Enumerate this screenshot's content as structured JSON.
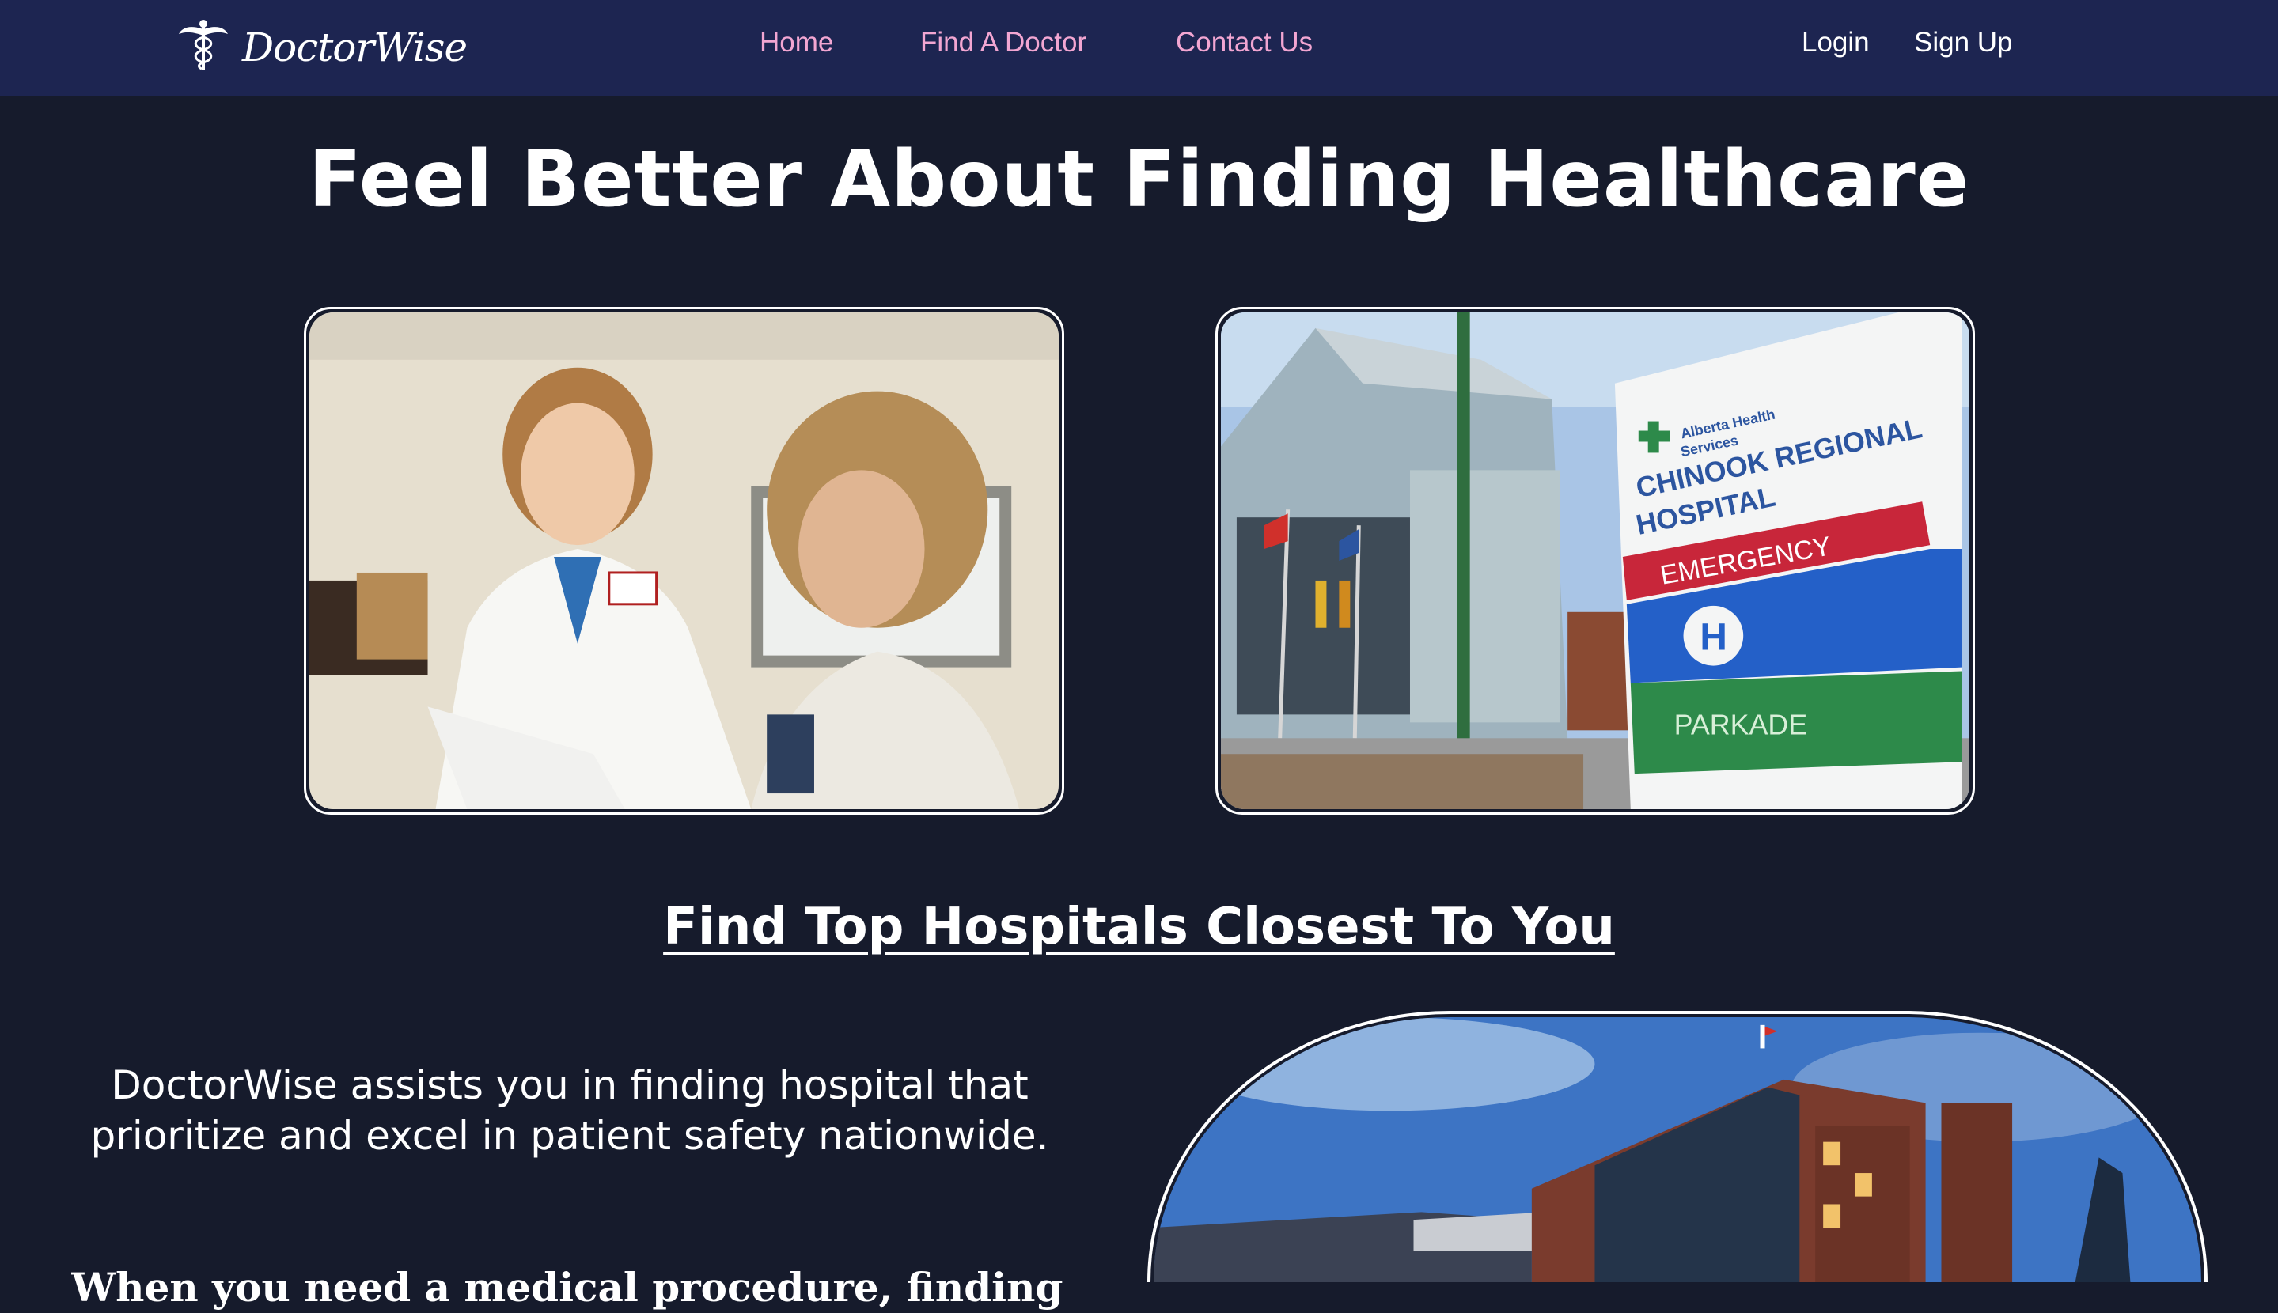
{
  "brand": {
    "name": "DoctorWise",
    "logo_icon": "caduceus-icon"
  },
  "nav": {
    "links": [
      "Home",
      "Find A Doctor",
      "Contact Us"
    ],
    "login": "Login",
    "signup": "Sign Up"
  },
  "hero": {
    "title": "Feel Better About Finding Healthcare",
    "images": [
      {
        "icon": "doctor-patient-photo"
      },
      {
        "icon": "hospital-sign-photo",
        "sign_lines": [
          "Alberta Health",
          "Services",
          "CHINOOK REGIONAL",
          "HOSPITAL",
          "EMERGENCY",
          "H",
          "PARKADE"
        ]
      }
    ]
  },
  "section": {
    "title": "Find Top Hospitals Closest To You",
    "lead": "DoctorWise assists you in finding hospital that prioritize and excel in patient safety nationwide.",
    "body_start": "When you need a medical procedure, finding the right doctor"
  },
  "colors": {
    "nav_bg": "#1d2551",
    "page_bg": "#161b2c",
    "nav_link": "#f2a6d2",
    "text": "#ffffff"
  }
}
